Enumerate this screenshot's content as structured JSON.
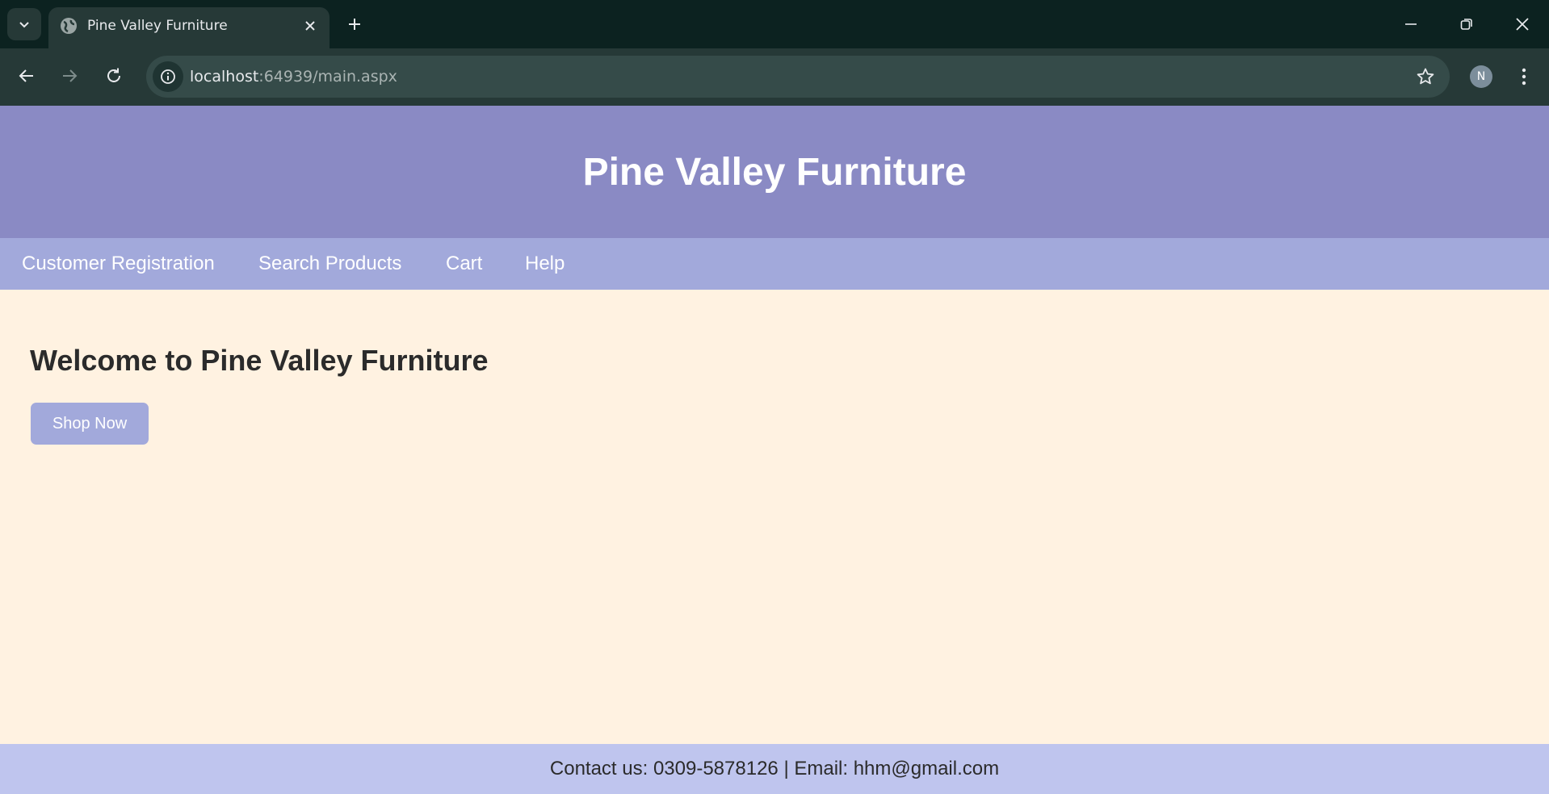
{
  "browser": {
    "tab_title": "Pine Valley Furniture",
    "url_host": "localhost",
    "url_rest": ":64939/main.aspx",
    "profile_initial": "N"
  },
  "header": {
    "title": "Pine Valley Furniture"
  },
  "nav": {
    "items": [
      {
        "label": "Customer Registration"
      },
      {
        "label": "Search Products"
      },
      {
        "label": "Cart"
      },
      {
        "label": "Help"
      }
    ]
  },
  "main": {
    "heading": "Welcome to Pine Valley Furniture",
    "shop_button": "Shop Now"
  },
  "footer": {
    "text": "Contact us: 0309-5878126 | Email: hhm@gmail.com"
  },
  "colors": {
    "header_bg": "#8a8ac4",
    "nav_bg": "#a2a9db",
    "content_bg": "#fff2e1",
    "footer_bg": "#bfc5ee"
  }
}
